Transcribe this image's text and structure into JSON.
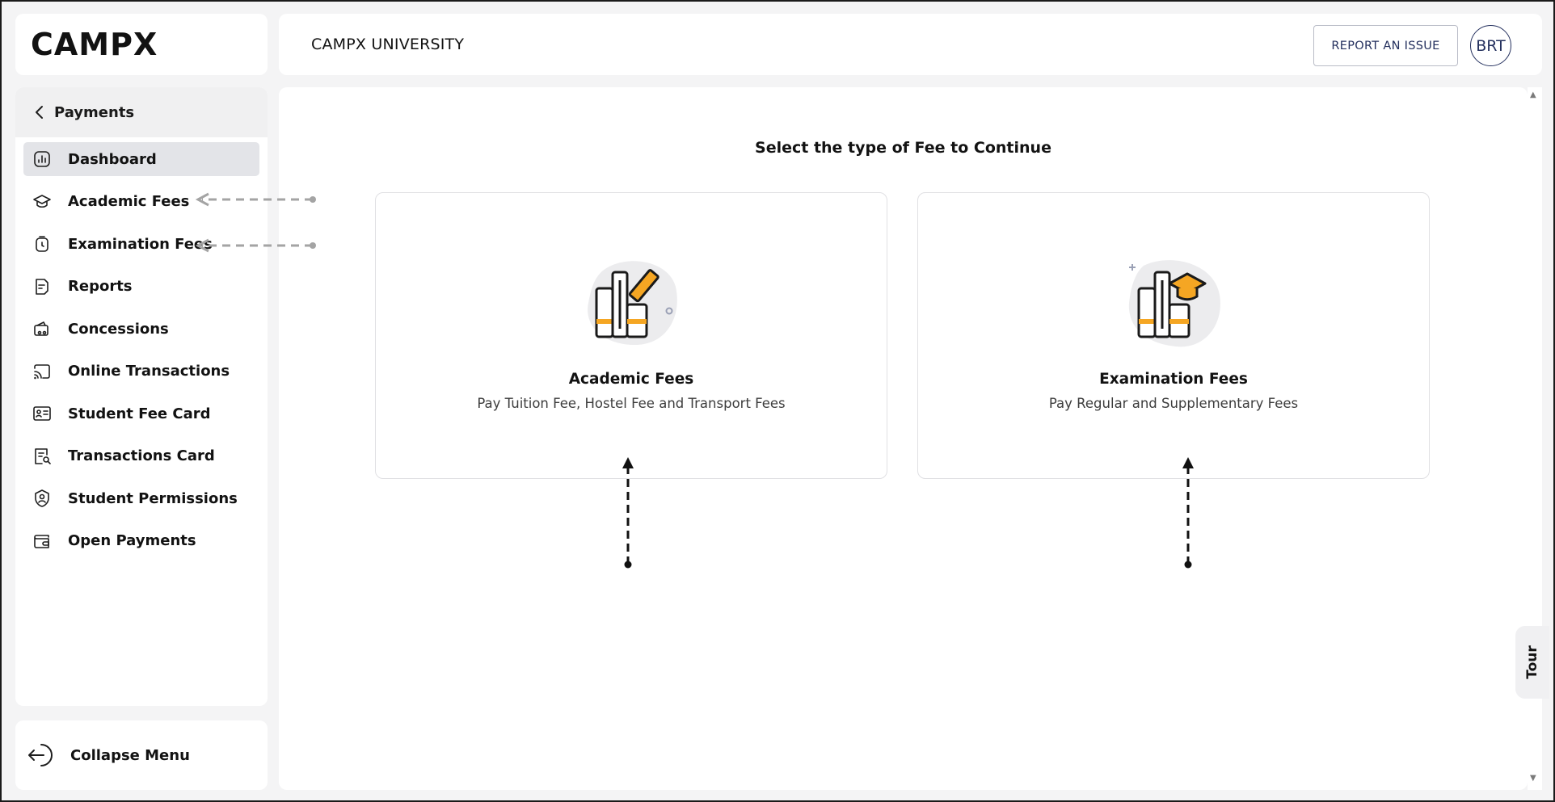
{
  "brand": {
    "logo_text": "CAMPX"
  },
  "header": {
    "org_name": "CAMPX UNIVERSITY",
    "report_button": "REPORT AN ISSUE",
    "avatar_initials": "BRT"
  },
  "sidebar": {
    "back_label": "Payments",
    "items": [
      {
        "label": "Dashboard",
        "icon": "dashboard-icon",
        "active": true
      },
      {
        "label": "Academic Fees",
        "icon": "graduation-cap-icon"
      },
      {
        "label": "Examination Fees",
        "icon": "stopwatch-icon"
      },
      {
        "label": "Reports",
        "icon": "report-icon"
      },
      {
        "label": "Concessions",
        "icon": "wallet-icon"
      },
      {
        "label": "Online Transactions",
        "icon": "cast-icon"
      },
      {
        "label": "Student Fee Card",
        "icon": "id-card-icon"
      },
      {
        "label": "Transactions Card",
        "icon": "receipt-search-icon"
      },
      {
        "label": "Student Permissions",
        "icon": "user-shield-icon"
      },
      {
        "label": "Open Payments",
        "icon": "purse-icon"
      }
    ],
    "collapse_label": "Collapse Menu"
  },
  "main": {
    "title": "Select the type of Fee to Continue",
    "cards": [
      {
        "title": "Academic Fees",
        "subtitle": "Pay Tuition Fee, Hostel Fee and Transport Fees",
        "icon": "books-pencil-icon"
      },
      {
        "title": "Examination Fees",
        "subtitle": "Pay Regular and Supplementary Fees",
        "icon": "books-graduation-cap-icon"
      }
    ]
  },
  "tour": {
    "label": "Tour"
  },
  "colors": {
    "accent_navy": "#24305e",
    "illustration_orange": "#f5a623",
    "active_nav_bg": "#e3e4e8"
  }
}
